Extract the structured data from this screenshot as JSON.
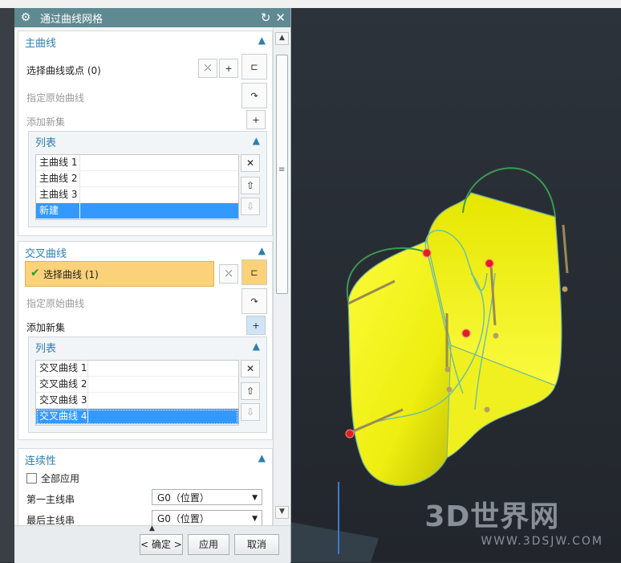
{
  "window": {
    "title": "通过曲线网格"
  },
  "primary": {
    "title": "主曲线",
    "select_label": "选择曲线或点 (0)",
    "specify_origin": "指定原始曲线",
    "add_new_set": "添加新集",
    "list": {
      "title": "列表",
      "items": [
        "主曲线 1",
        "主曲线 2",
        "主曲线 3",
        "新建"
      ]
    }
  },
  "cross": {
    "title": "交叉曲线",
    "select_label": "选择曲线 (1)",
    "specify_origin": "指定原始曲线",
    "add_new_set": "添加新集",
    "list": {
      "title": "列表",
      "items": [
        "交叉曲线 1",
        "交叉曲线 2",
        "交叉曲线 3",
        "交叉曲线 4"
      ]
    }
  },
  "continuity": {
    "title": "连续性",
    "apply_all": "全部应用",
    "first_primary_label": "第一主线串",
    "first_primary_value": "G0（位置）",
    "last_primary_label": "最后主线串",
    "last_primary_value": "G0（位置）"
  },
  "buttons": {
    "ok": "< 确定 >",
    "apply": "应用",
    "cancel": "取消"
  },
  "watermark": {
    "main": "3D世界网",
    "sub": "WWW.3DSJW.COM"
  },
  "colors": {
    "titlebar": "#5f8a92",
    "accent": "#2c7fb0",
    "highlight": "#fbd27a",
    "selection": "#3399ff",
    "surface": "#f2f21a"
  },
  "icons": {
    "settings": "gear-icon",
    "reset": "reset-icon",
    "close": "close-icon",
    "check": "check-icon"
  }
}
